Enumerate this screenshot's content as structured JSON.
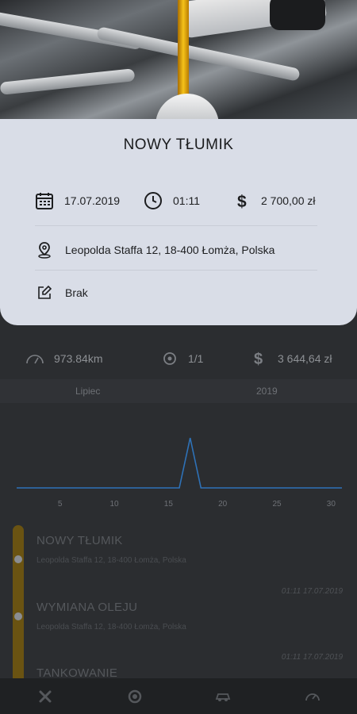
{
  "modal": {
    "title": "NOWY TŁUMIK",
    "date": "17.07.2019",
    "time": "01:11",
    "price": "2 700,00 zł",
    "address": "Leopolda Staffa 12, 18-400 Łomża, Polska",
    "note": "Brak",
    "icons": [
      "calendar-icon",
      "clock-icon",
      "dollar-icon",
      "location-pin-icon",
      "edit-icon"
    ]
  },
  "stats": {
    "distance": "973.84km",
    "count": "1/1",
    "total": "3 644,64 zł"
  },
  "period": {
    "month": "Lipiec",
    "year": "2019"
  },
  "chart_data": {
    "type": "line",
    "x": [
      1,
      2,
      3,
      4,
      5,
      6,
      7,
      8,
      9,
      10,
      11,
      12,
      13,
      14,
      15,
      16,
      17,
      18,
      19,
      20,
      21,
      22,
      23,
      24,
      25,
      26,
      27,
      28,
      29,
      30,
      31
    ],
    "series": [
      {
        "values": [
          0,
          0,
          0,
          0,
          0,
          0,
          0,
          0,
          0,
          0,
          0.1,
          0,
          0,
          0,
          0,
          0,
          2700,
          0,
          0,
          0,
          0,
          0,
          0,
          0,
          0,
          0,
          0,
          0,
          0,
          0,
          0.6
        ]
      }
    ],
    "x_tick_labels": [
      "5",
      "10",
      "15",
      "20",
      "25",
      "30"
    ],
    "x_ticks": [
      5,
      10,
      15,
      20,
      25,
      30
    ],
    "xlim": [
      1,
      31
    ],
    "ylim": [
      0,
      3000
    ],
    "color": "#2e72b8"
  },
  "entries": [
    {
      "title": "NOWY TŁUMIK",
      "address": "Leopolda Staffa 12, 18-400 Łomża, Polska",
      "date": "01:11 17.07.2019"
    },
    {
      "title": "WYMIANA OLEJU",
      "address": "Leopolda Staffa 12, 18-400 Łomża, Polska",
      "date": "01:11 17.07.2019"
    },
    {
      "title": "TANKOWANIE"
    }
  ],
  "nav": {
    "items": [
      "tools-icon",
      "car-service-icon",
      "car-icon",
      "speedometer-icon"
    ]
  },
  "colors": {
    "modal_bg": "#d9dde7",
    "accent": "#f5c21a",
    "chart_line": "#2e72b8",
    "dark_bg": "#2b2d30"
  }
}
